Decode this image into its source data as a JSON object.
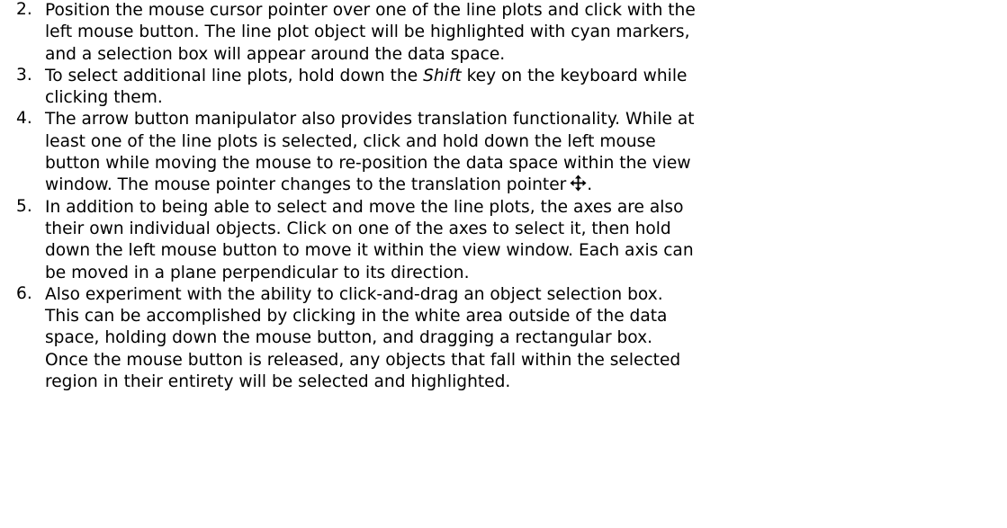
{
  "steps": [
    {
      "number": "2.",
      "lines": [
        "Position the mouse cursor pointer over one of the line plots and click with the",
        "left mouse button.  The line plot object will be highlighted with cyan markers,",
        "and a selection box will appear around the data space."
      ]
    },
    {
      "number": "3.",
      "line1_before": "To select additional line plots, hold down the ",
      "line1_emph": "Shift",
      "line1_after": " key on the keyboard while",
      "line2": "clicking them."
    },
    {
      "number": "4.",
      "lines": [
        "The arrow button manipulator also provides translation functionality.  While at",
        "least one of the line plots is selected, click and hold down the left mouse",
        "button while moving the mouse to re-position the data space within the view"
      ],
      "last_line": "window.  The mouse pointer changes to the translation pointer",
      "icon": "move-arrows-icon",
      "last_line_end": "."
    },
    {
      "number": "5.",
      "lines": [
        "In addition to being able to select and move the line plots, the axes are also",
        "their own individual objects.  Click on one of the axes to select it, then hold",
        "down the left mouse button to move it within the view window.  Each axis can",
        "be moved in a plane perpendicular to its direction."
      ]
    },
    {
      "number": "6.",
      "lines": [
        "Also experiment with the ability to click-and-drag an object selection box.",
        "This can be accomplished by clicking in the white area outside of the data",
        "space, holding down the mouse button, and dragging a rectangular box.",
        "Once the mouse button is released, any objects that fall within the selected",
        "region in their entirety will be selected and highlighted."
      ]
    }
  ]
}
